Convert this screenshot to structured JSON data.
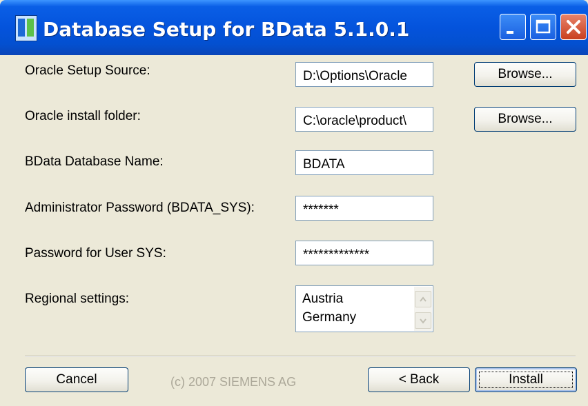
{
  "window": {
    "title": "Database Setup for BData 5.1.0.1",
    "icon": "app-database-icon",
    "controls": [
      "minimize-icon",
      "maximize-icon",
      "close-icon"
    ]
  },
  "form": {
    "oracle_setup_source": {
      "label": "Oracle Setup Source:",
      "value": "D:\\Options\\Oracle",
      "browse_label": "Browse..."
    },
    "oracle_install_folder": {
      "label": "Oracle install folder:",
      "value": "C:\\oracle\\product\\",
      "browse_label": "Browse..."
    },
    "database_name": {
      "label": "BData Database Name:",
      "value": "BDATA"
    },
    "admin_password": {
      "label": "Administrator Password (BDATA_SYS):",
      "value": "*******"
    },
    "sys_password": {
      "label": "Password for User SYS:",
      "value": "*************"
    },
    "regional_settings": {
      "label": "Regional settings:",
      "options": [
        "Austria",
        "Germany"
      ]
    }
  },
  "footer": {
    "cancel_label": "Cancel",
    "copyright": "(c) 2007 SIEMENS AG",
    "back_label": "< Back",
    "install_label": "Install"
  },
  "colors": {
    "titlebar": "#0453dc",
    "face": "#ece9d8",
    "field_border": "#7f9db9",
    "button_border": "#003c74",
    "disabled_text": "#aca899"
  }
}
